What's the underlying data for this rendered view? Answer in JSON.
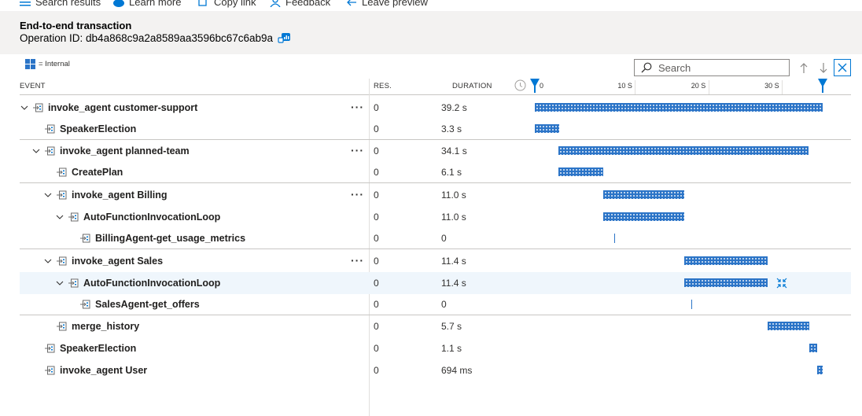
{
  "toolbar": {
    "items": [
      {
        "label": "Search results",
        "icon": "list-icon"
      },
      {
        "label": "Learn more",
        "icon": "cloud-icon"
      },
      {
        "label": "Copy link",
        "icon": "link-icon"
      },
      {
        "label": "Feedback",
        "icon": "person-icon"
      },
      {
        "label": "Leave preview",
        "icon": "back-arrow-icon"
      }
    ]
  },
  "header": {
    "title": "End-to-end transaction",
    "operation_id": "Operation ID: db4a868c9a2a8589aa3596bc67c6ab9a"
  },
  "legend": {
    "label": "= Internal",
    "icon": "internal-icon"
  },
  "search": {
    "placeholder": "Search",
    "value": ""
  },
  "columns": {
    "event": "EVENT",
    "res": "RES.",
    "duration": "DURATION"
  },
  "timeline": {
    "ticks": [
      "0",
      "10 S",
      "20 S",
      "30 S"
    ],
    "tick_values_s": [
      0,
      10,
      20,
      30
    ],
    "range_s": [
      0,
      39.2
    ]
  },
  "colors": {
    "accent": "#0078d4",
    "bar": "#2b74c7",
    "header_bg": "#f3f2f1",
    "selected_bg": "#eff6fc"
  },
  "rows": [
    {
      "name": "invoke_agent customer-support",
      "depth": 0,
      "expandable": true,
      "more": true,
      "res": "0",
      "duration": "39.2 s",
      "start_s": 0,
      "dur_s": 39.2
    },
    {
      "name": "SpeakerElection",
      "depth": 1,
      "expandable": false,
      "more": false,
      "res": "0",
      "duration": "3.3 s",
      "start_s": 0,
      "dur_s": 3.3
    },
    {
      "name": "invoke_agent planned-team",
      "depth": 1,
      "expandable": true,
      "more": true,
      "res": "0",
      "duration": "34.1 s",
      "start_s": 3.2,
      "dur_s": 34.1
    },
    {
      "name": "CreatePlan",
      "depth": 2,
      "expandable": false,
      "more": false,
      "res": "0",
      "duration": "6.1 s",
      "start_s": 3.2,
      "dur_s": 6.1
    },
    {
      "name": "invoke_agent Billing",
      "depth": 2,
      "expandable": true,
      "more": true,
      "res": "0",
      "duration": "11.0 s",
      "start_s": 9.3,
      "dur_s": 11.0
    },
    {
      "name": "AutoFunctionInvocationLoop",
      "depth": 3,
      "expandable": true,
      "more": false,
      "res": "0",
      "duration": "11.0 s",
      "start_s": 9.3,
      "dur_s": 11.0
    },
    {
      "name": "BillingAgent-get_usage_metrics",
      "depth": 4,
      "expandable": false,
      "more": false,
      "res": "0",
      "duration": "0",
      "start_s": 10.8,
      "dur_s": 0
    },
    {
      "name": "invoke_agent Sales",
      "depth": 2,
      "expandable": true,
      "more": true,
      "res": "0",
      "duration": "11.4 s",
      "start_s": 20.3,
      "dur_s": 11.4
    },
    {
      "name": "AutoFunctionInvocationLoop",
      "depth": 3,
      "expandable": true,
      "more": false,
      "res": "0",
      "duration": "11.4 s",
      "start_s": 20.3,
      "dur_s": 11.4,
      "selected": true,
      "collapse_icon": true
    },
    {
      "name": "SalesAgent-get_offers",
      "depth": 4,
      "expandable": false,
      "more": false,
      "res": "0",
      "duration": "0",
      "start_s": 21.3,
      "dur_s": 0
    },
    {
      "name": "merge_history",
      "depth": 2,
      "expandable": false,
      "more": false,
      "res": "0",
      "duration": "5.7 s",
      "start_s": 31.7,
      "dur_s": 5.7
    },
    {
      "name": "SpeakerElection",
      "depth": 1,
      "expandable": false,
      "more": false,
      "res": "0",
      "duration": "1.1 s",
      "start_s": 37.4,
      "dur_s": 1.1
    },
    {
      "name": "invoke_agent User",
      "depth": 1,
      "expandable": false,
      "more": false,
      "res": "0",
      "duration": "694 ms",
      "start_s": 38.5,
      "dur_s": 0.694
    }
  ]
}
